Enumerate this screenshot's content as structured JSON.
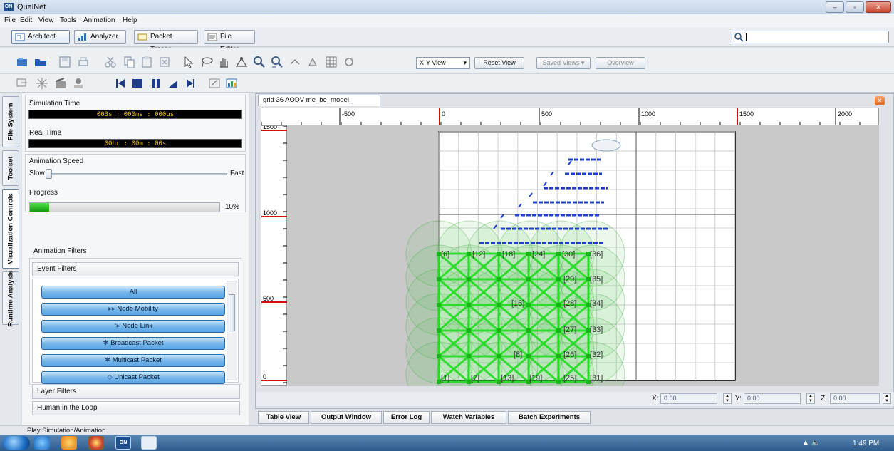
{
  "window": {
    "app_title": "QualNet",
    "logo": "ON",
    "min": "–",
    "max": "▫",
    "close": "✕"
  },
  "menu": [
    "File",
    "Edit",
    "View",
    "Tools",
    "Animation",
    "Help"
  ],
  "main_tabs": [
    "Architect",
    "Analyzer",
    "Packet Tracer",
    "File Editor"
  ],
  "search": {
    "placeholder": ""
  },
  "view_toolbar": {
    "view_select": "X-Y View",
    "reset_view": "Reset View",
    "saved_views": "Saved Views ▾",
    "overview": "Overview"
  },
  "side_tabs": [
    "File System",
    "Toolset",
    "Visualization Controls",
    "Runtime Analysis"
  ],
  "panel": {
    "sim_time_label": "Simulation Time",
    "sim_time_value": "003s : 000ms : 000us",
    "real_time_label": "Real Time",
    "real_time_value": "00hr : 00m : 00s",
    "anim_speed_label": "Animation Speed",
    "slow": "Slow",
    "fast": "Fast",
    "progress_label": "Progress",
    "progress_value": "10%",
    "progress_fraction": 0.1,
    "anim_filters_label": "Animation Filters",
    "event_filters_label": "Event Filters",
    "filters": [
      "All",
      "Node Mobility",
      "Node Link",
      "Broadcast Packet",
      "Multicast Packet",
      "Unicast Packet"
    ],
    "filter_icons": [
      "",
      "▸▸",
      "°▸",
      "✱",
      "✱",
      "◇"
    ],
    "layer_filters": "Layer Filters",
    "human_in_loop": "Human in the Loop"
  },
  "canvas": {
    "doc_tab": "grid 36  AODV me_be_model_",
    "close": "×",
    "x_ruler": [
      "-500",
      "0",
      "500",
      "1000",
      "1500",
      "2000"
    ],
    "y_ruler": [
      "1500",
      "1000",
      "500",
      "0"
    ],
    "node_labels": [
      "[6]",
      "[12]",
      "[18]",
      "[24]",
      "[30]",
      "[36]",
      "[35]",
      "[29]",
      "[28]",
      "[34]",
      "[33]",
      "[27]",
      "[26]",
      "[32]",
      "[25]",
      "[31]",
      "[1]",
      "[7]",
      "[13]",
      "[19]",
      "[8]",
      "[16]"
    ]
  },
  "coords": {
    "x_label": "X:",
    "x": "0.00",
    "y_label": "Y:",
    "y": "0.00",
    "z_label": "Z:",
    "z": "0.00"
  },
  "bottom_tabs": [
    "Table View",
    "Output Window",
    "Error Log",
    "Watch Variables",
    "Batch Experiments"
  ],
  "status": "Play Simulation/Animation",
  "taskbar": {
    "clock": "1:49 PM",
    "tray": "▲ 🔈"
  },
  "colors": {
    "accent": "#1f4e8c",
    "node_green": "#22dd22",
    "packet_blue": "#1f3fd0",
    "red_ruler": "#d01010"
  }
}
